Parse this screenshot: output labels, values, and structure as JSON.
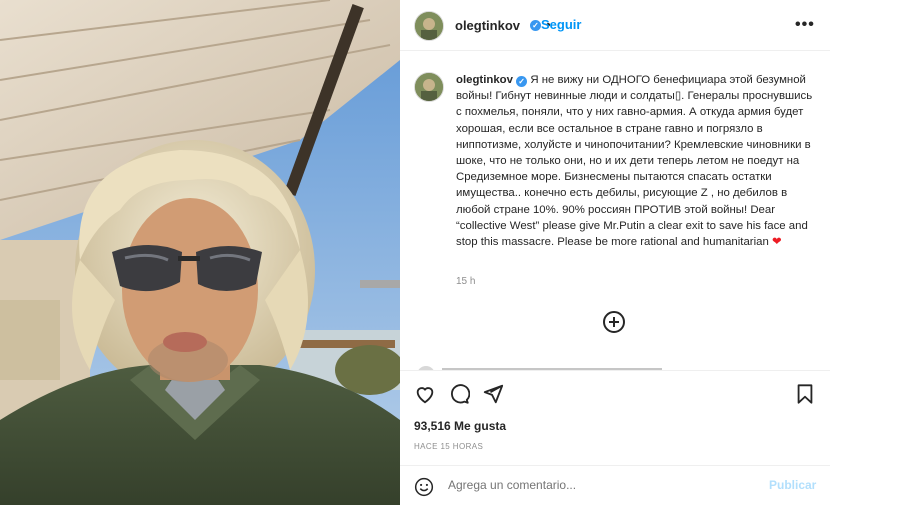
{
  "post": {
    "username": "olegtinkov",
    "follow_label": "Seguir",
    "separator": "•",
    "more_label": "•••",
    "caption_text": "Я не вижу ни ОДНОГО бенефициара этой безумной войны! Гибнут невинные люди и солдаты▯. Генералы проснувшись с похмелья, поняли, что у них гавно-армия. А откуда армия будет хорошая, если все остальное в стране гавно и погрязло в ниппотизме, холуйсте и чинопочитании? Кремлевские чиновники в шоке, что не только они, но и их дети теперь летом не поедут на Средиземное море. Бизнесмены пытаются спасать остатки имущества.. конечно есть дебилы, рисующие Z , но дебилов в любой стране 10%. 90% россиян ПРОТИВ этой войны! Dear “collective West” please give Mr.Putin a clear exit to save his face and stop this massacre. Please be more rational and humanitarian",
    "caption_emoji": "❤",
    "caption_time": "15 h",
    "likes": "93,516 Me gusta",
    "time_ago": "HACE 15 HORAS",
    "comment_placeholder": "Agrega un comentario...",
    "publish_label": "Publicar"
  },
  "icons": [
    "verified-badge-icon",
    "add-circle-icon",
    "heart-icon",
    "comment-icon",
    "share-icon",
    "bookmark-icon",
    "emoji-icon"
  ],
  "colors": {
    "link_blue": "#0095f6",
    "publish_blue": "#b2dffc",
    "heart_red": "#ed1c24",
    "text": "#262626",
    "muted": "#8e8e8e"
  }
}
